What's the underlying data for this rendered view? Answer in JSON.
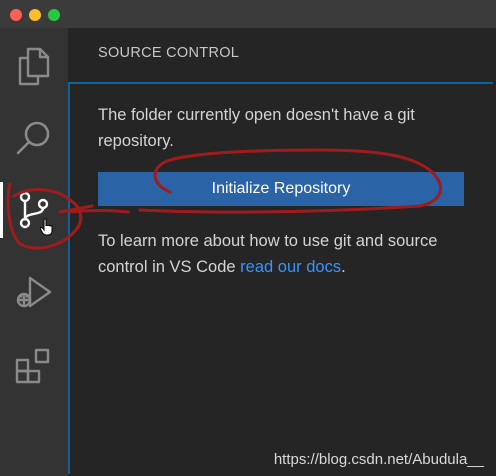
{
  "window": {
    "traffic_lights": [
      "close",
      "minimize",
      "maximize"
    ],
    "colors": {
      "close": "#fe5f57",
      "minimize": "#febc2e",
      "maximize": "#28c840"
    }
  },
  "activity_bar": {
    "items": [
      {
        "icon": "files-icon",
        "active": false
      },
      {
        "icon": "search-icon",
        "active": false
      },
      {
        "icon": "source-control-icon",
        "active": true
      },
      {
        "icon": "run-debug-icon",
        "active": false
      },
      {
        "icon": "extensions-icon",
        "active": false
      }
    ]
  },
  "sidebar": {
    "header": "SOURCE CONTROL",
    "message": "The folder currently open doesn't have a git repository.",
    "initialize_button": "Initialize Repository",
    "learn_more_prefix": "To learn more about how to use git and source control in VS Code ",
    "learn_more_link": "read our docs",
    "learn_more_suffix": "."
  },
  "watermark": "https://blog.csdn.net/Abudula__",
  "colors": {
    "accent": "#2b63a7",
    "link": "#3794ff",
    "annotation": "#a01c1c"
  }
}
